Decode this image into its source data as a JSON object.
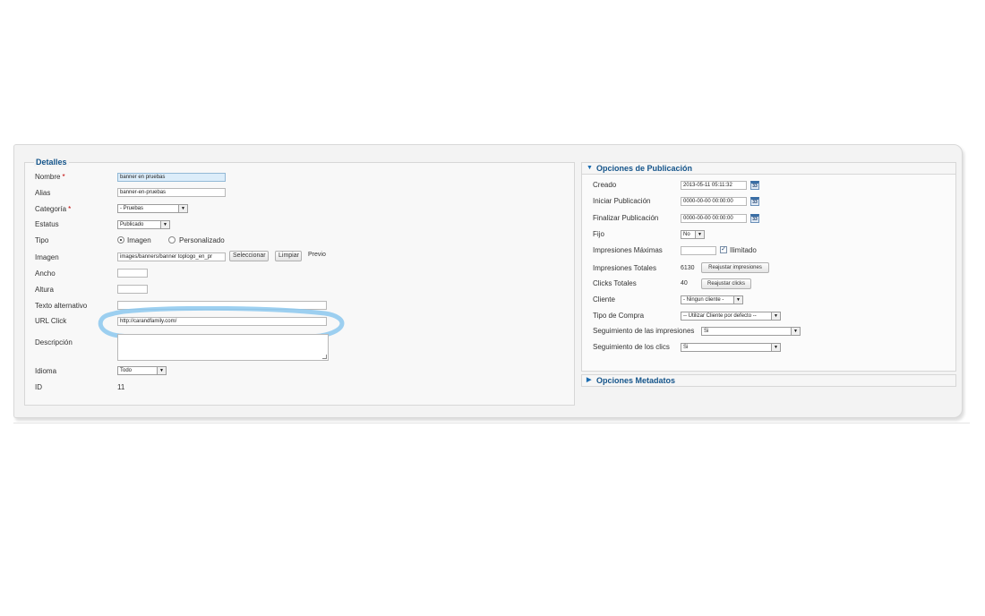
{
  "details": {
    "legend": "Detalles",
    "labels": {
      "nombre": "Nombre",
      "alias": "Alias",
      "categoria": "Categoría",
      "estatus": "Estatus",
      "tipo": "Tipo",
      "imagen": "Imagen",
      "ancho": "Ancho",
      "altura": "Altura",
      "texto_alternativo": "Texto alternativo",
      "url_click": "URL Click",
      "descripcion": "Descripción",
      "idioma": "Idioma",
      "id": "ID"
    },
    "required_mark": "*",
    "nombre_value": "banner en pruebas",
    "alias_value": "banner-en-pruebas",
    "categoria_value": "- Pruebas",
    "estatus_value": "Publicado",
    "tipo_options": [
      "Imagen",
      "Personalizado"
    ],
    "tipo_selected": "Imagen",
    "imagen_value": "images/banners/banner toplogo_en_pr",
    "seleccionar_label": "Seleccionar",
    "limpiar_label": "Limpiar",
    "previo_label": "Previo",
    "ancho_value": "",
    "altura_value": "",
    "texto_alternativo_value": "",
    "url_click_value": "http://carandfamily.com/",
    "descripcion_value": "",
    "idioma_value": "Todo",
    "id_value": "11"
  },
  "publishing": {
    "header": "Opciones de Publicación",
    "labels": {
      "creado": "Creado",
      "iniciar": "Iniciar Publicación",
      "finalizar": "Finalizar Publicación",
      "fijo": "Fijo",
      "impresiones_maximas": "Impresiones Máximas",
      "impresiones_totales": "Impresiones Totales",
      "clicks_totales": "Clicks Totales",
      "cliente": "Cliente",
      "tipo_compra": "Tipo de Compra",
      "seguimiento_impresiones": "Seguimiento de las impresiones",
      "seguimiento_clics": "Seguimiento de los clics"
    },
    "creado_value": "2013-05-11 05:11:32",
    "iniciar_value": "0000-00-00 00:00:00",
    "finalizar_value": "0000-00-00 00:00:00",
    "calendar_icon_text": "33",
    "fijo_value": "No",
    "impresiones_maximas_value": "",
    "ilimitado_label": "Ilimitado",
    "ilimitado_checked": true,
    "impresiones_totales_value": "6130",
    "reajustar_impresiones_label": "Reajustar impresiones",
    "clicks_totales_value": "40",
    "reajustar_clicks_label": "Reajustar clicks",
    "cliente_value": "- Ningun cliente -",
    "tipo_compra_value": "-- Utilizar Cliente por defecto --",
    "seguimiento_impresiones_value": "Si",
    "seguimiento_clics_value": "Si"
  },
  "metadata": {
    "header": "Opciones Metadatos"
  },
  "colors": {
    "accent": "#14548a",
    "highlight_circle": "#8cc8ee",
    "required": "#c00000",
    "input_highlight": "#dcedfa"
  },
  "icons": {
    "dropdown": "chevron-down-icon",
    "calendar": "calendar-icon",
    "expanded": "triangle-down-icon",
    "collapsed": "triangle-right-icon"
  }
}
